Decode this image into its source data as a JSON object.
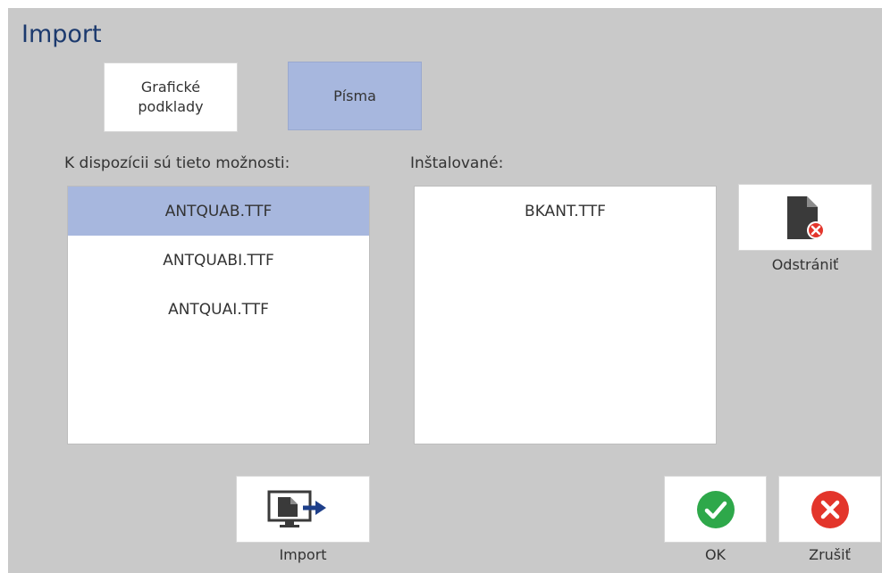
{
  "dialog": {
    "title": "Import"
  },
  "tabs": [
    {
      "label": "Grafické\npodklady",
      "selected": false
    },
    {
      "label": "Písma",
      "selected": true
    }
  ],
  "available": {
    "label": "K dispozícii sú tieto možnosti:",
    "items": [
      "ANTQUAB.TTF",
      "ANTQUABI.TTF",
      "ANTQUAI.TTF"
    ],
    "selected_index": 0
  },
  "installed": {
    "label": "Inštalované:",
    "items": [
      "BKANT.TTF"
    ]
  },
  "buttons": {
    "remove_label": "Odstrániť",
    "import_label": "Import",
    "ok_label": "OK",
    "cancel_label": "Zrušiť"
  },
  "colors": {
    "title": "#1c3a6e",
    "selection": "#a7b7de",
    "ok_green": "#2ea84a",
    "cancel_red": "#e3352b",
    "icon_dark": "#3a3a3a",
    "arrow_blue": "#1e3f8a"
  },
  "icons": {
    "remove": "document-remove-icon",
    "import": "monitor-import-icon",
    "ok": "checkmark-icon",
    "cancel": "close-icon"
  }
}
